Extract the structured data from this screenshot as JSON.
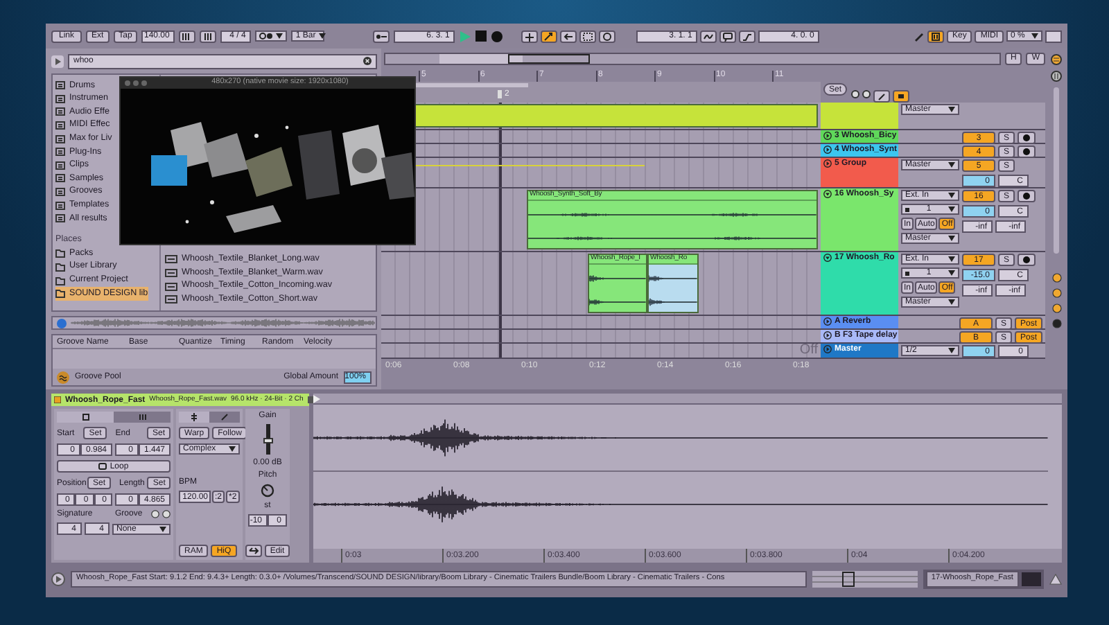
{
  "transport": {
    "link": "Link",
    "ext": "Ext",
    "tap": "Tap",
    "tempo": "140.00",
    "signature": "4 / 4",
    "quantize": "1 Bar",
    "position": "6. 3. 1",
    "playing": true,
    "follow": true,
    "loop_start": "3. 1. 1",
    "loop_length": "4. 0. 0",
    "key_map": true,
    "key": "Key",
    "midi": "MIDI",
    "cpu": "0 %"
  },
  "browser": {
    "search": "whoo",
    "categories": [
      {
        "label": "Drums",
        "selected": false
      },
      {
        "label": "Instrumen",
        "selected": false
      },
      {
        "label": "Audio Effe",
        "selected": false
      },
      {
        "label": "MIDI Effec",
        "selected": false
      },
      {
        "label": "Max for Liv",
        "selected": false
      },
      {
        "label": "Plug-Ins",
        "selected": false
      },
      {
        "label": "Clips",
        "selected": false
      },
      {
        "label": "Samples",
        "selected": false
      },
      {
        "label": "Grooves",
        "selected": false
      },
      {
        "label": "Templates",
        "selected": false
      },
      {
        "label": "All results",
        "selected": false
      }
    ],
    "places_heading": "Places",
    "places": [
      {
        "label": "Packs",
        "selected": false
      },
      {
        "label": "User Library",
        "selected": false
      },
      {
        "label": "Current Project",
        "selected": false
      },
      {
        "label": "SOUND DESIGN lib",
        "selected": true
      }
    ],
    "files": [
      "Whoosh_Textile_Blanket_Long.wav",
      "Whoosh_Textile_Blanket_Warm.wav",
      "Whoosh_Textile_Cotton_Incoming.wav",
      "Whoosh_Textile_Cotton_Short.wav"
    ]
  },
  "video": {
    "title": "480x270 (native movie size: 1920x1080)",
    "kind": "picture"
  },
  "groove_pool": {
    "columns": [
      "Groove Name",
      "Base",
      "Quantize",
      "Timing",
      "Random",
      "Velocity"
    ],
    "title": "Groove Pool",
    "amount_label": "Global Amount",
    "amount": "100%"
  },
  "arrangement": {
    "overview": {
      "h": "H",
      "w": "W"
    },
    "bars": [
      "5",
      "6",
      "7",
      "8",
      "9",
      "10",
      "11"
    ],
    "marker": "2",
    "set": "Set",
    "times": [
      "0:06",
      "0:08",
      "0:10",
      "0:12",
      "0:14",
      "0:16",
      "0:18"
    ],
    "off": "Off",
    "tracks": [
      {
        "kind": "top",
        "color": "#c6e33a",
        "output": "Master",
        "clips": [
          {
            "color": "#c6e33a",
            "selected": false
          }
        ]
      },
      {
        "kind": "slim",
        "name": "3 Whoosh_Bicy",
        "color": "#5fd85a",
        "expanded": false,
        "number": "3",
        "active": true,
        "solo": "S",
        "arm": false
      },
      {
        "kind": "slim",
        "name": "4 Whoosh_Synt",
        "color": "#3cc6ef",
        "expanded": false,
        "number": "4",
        "active": true,
        "solo": "S",
        "arm": false
      },
      {
        "kind": "group",
        "name": "5 Group",
        "color": "#f25b4c",
        "expanded": false,
        "output": "Master",
        "number": "5",
        "active": true,
        "solo": "S",
        "volume": "0",
        "pan": "C",
        "automation": true
      },
      {
        "kind": "tall",
        "name": "16 Whoosh_Sy",
        "color": "#7ae66c",
        "expanded": true,
        "input": "Ext. In",
        "channel": "1",
        "monitor": [
          {
            "label": "In",
            "selected": false
          },
          {
            "label": "Auto",
            "selected": false
          },
          {
            "label": "Off",
            "selected": true
          }
        ],
        "output": "Master",
        "number": "16",
        "active": true,
        "solo": "S",
        "arm": false,
        "volume": "0",
        "pan": "C",
        "meters": [
          "-inf",
          "-inf"
        ],
        "clips": [
          {
            "name": "Whoosh_Synth_Soft_By",
            "color": "#86e67a",
            "selected": false
          }
        ]
      },
      {
        "kind": "tall",
        "name": "17 Whoosh_Ro",
        "color": "#2fdcaa",
        "expanded": true,
        "input": "Ext. In",
        "channel": "1",
        "monitor": [
          {
            "label": "In",
            "selected": false
          },
          {
            "label": "Auto",
            "selected": false
          },
          {
            "label": "Off",
            "selected": true
          }
        ],
        "output": "Master",
        "number": "17",
        "active": true,
        "solo": "S",
        "arm": false,
        "volume": "-15.0",
        "pan": "C",
        "meters": [
          "-inf",
          "-inf"
        ],
        "clips": [
          {
            "name": "Whoosh_Rope_I",
            "color": "#86e67a",
            "selected": false
          },
          {
            "name": "Whoosh_Ro",
            "color": "#86e67a",
            "selected": true
          }
        ]
      },
      {
        "kind": "return",
        "name": "A Reverb",
        "color": "#5a8ef2",
        "expanded": false,
        "number": "A",
        "active": true,
        "solo": "S",
        "post": "Post"
      },
      {
        "kind": "return",
        "name": "B F3 Tape delay",
        "color": "#a9b9f7",
        "expanded": false,
        "number": "B",
        "active": true,
        "solo": "S",
        "post": "Post"
      },
      {
        "kind": "master",
        "name": "Master",
        "color": "#1f78c6",
        "expanded": false,
        "output": "1/2",
        "volume": "0",
        "pan": "0"
      }
    ]
  },
  "clip": {
    "name": "Whoosh_Rope_Fast",
    "file": "Whoosh_Rope_Fast.wav",
    "format": "96.0 kHz · 24-Bit · 2 Ch",
    "tabs": [
      {
        "selected": true
      },
      {
        "selected": false
      }
    ],
    "sample_tabs": [
      {
        "selected": true
      },
      {
        "selected": false
      }
    ],
    "start": {
      "label": "Start",
      "set": "Set",
      "values": [
        "0",
        "0.984"
      ]
    },
    "end": {
      "label": "End",
      "set": "Set",
      "values": [
        "0",
        "1.447"
      ]
    },
    "loop": {
      "label": "Loop",
      "on": false
    },
    "position": {
      "label": "Position",
      "set": "Set",
      "values": [
        "0",
        "0",
        "0"
      ]
    },
    "length": {
      "label": "Length",
      "set": "Set",
      "values": [
        "0",
        "4.865"
      ]
    },
    "signature": {
      "label": "Signature",
      "values": [
        "4",
        "4"
      ]
    },
    "groove": {
      "label": "Groove",
      "value": "None"
    }
  },
  "sample": {
    "warp": {
      "label": "Warp",
      "on": false
    },
    "follow": "Follow",
    "mode": "Complex",
    "bpm_label": "BPM",
    "bpm": "120.00",
    "half": ":2",
    "double": "*2",
    "ram": {
      "label": "RAM",
      "on": false
    },
    "hiq": {
      "label": "HiQ",
      "on": true
    },
    "gain": {
      "label": "Gain",
      "level": 0.45,
      "reading": "0.00 dB"
    },
    "pitch": {
      "label": "Pitch",
      "unit": "st",
      "values": [
        "-10",
        "0"
      ]
    },
    "edit": "Edit",
    "times": [
      "0:03",
      "0:03.200",
      "0:03.400",
      "0:03.600",
      "0:03.800",
      "0:04",
      "0:04.200"
    ]
  },
  "status": {
    "text": "Whoosh_Rope_Fast  Start: 9.1.2  End: 9.4.3+  Length: 0.3.0+  /Volumes/Transcend/SOUND DESIGN/library/Boom Library - Cinematic Trailers Bundle/Boom Library - Cinematic Trailers - Cons",
    "track": "17-Whoosh_Rope_Fast"
  }
}
